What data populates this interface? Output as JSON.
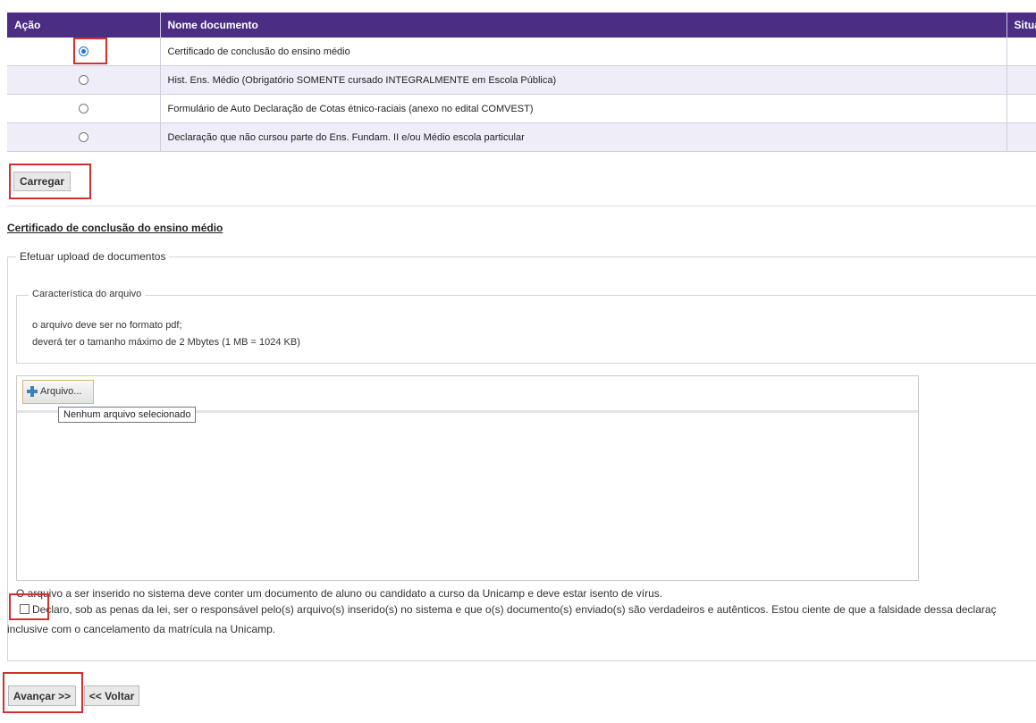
{
  "table": {
    "headers": [
      "Ação",
      "Nome documento",
      "Situa"
    ],
    "rows": [
      {
        "name": "Certificado de conclusão do ensino médio",
        "selected": true
      },
      {
        "name": "Hist. Ens. Médio (Obrigatório SOMENTE cursado INTEGRALMENTE em Escola Pública)",
        "selected": false
      },
      {
        "name": "Formulário de Auto Declaração de Cotas étnico-raciais (anexo no edital COMVEST)",
        "selected": false
      },
      {
        "name": "Declaração que não cursou parte do Ens. Fundam. II e/ou Médio escola particular",
        "selected": false
      }
    ]
  },
  "carregar_label": "Carregar",
  "section_title": "Certificado de conclusão do ensino médio",
  "upload": {
    "legend": "Efetuar upload de documentos",
    "char_legend": "Característica do arquivo",
    "rule1": "o arquivo deve ser no formato pdf;",
    "rule2": "deverá ter o tamanho máximo de 2 Mbytes (1 MB = 1024 KB)",
    "file_button": "Arquivo...",
    "tooltip": "Nenhum arquivo selecionado",
    "virus_note": "O arquivo a ser inserido no sistema deve conter um documento de aluno ou candidato a curso da Unicamp e deve estar isento de vírus.",
    "declaration_line1": "Declaro, sob as penas da lei, ser o responsável pelo(s) arquivo(s) inserido(s) no sistema e que o(s) documento(s) enviado(s) são verdadeiros e autênticos. Estou ciente de que a falsidade dessa declaraç",
    "declaration_line2": "inclusive com o cancelamento da matrícula na Unicamp."
  },
  "nav": {
    "next_label": "Avançar >>",
    "back_label": "<< Voltar"
  },
  "colors": {
    "header_bg": "#4b2e83",
    "highlight": "#d32f2f",
    "radio_selected": "#1a73e8"
  }
}
